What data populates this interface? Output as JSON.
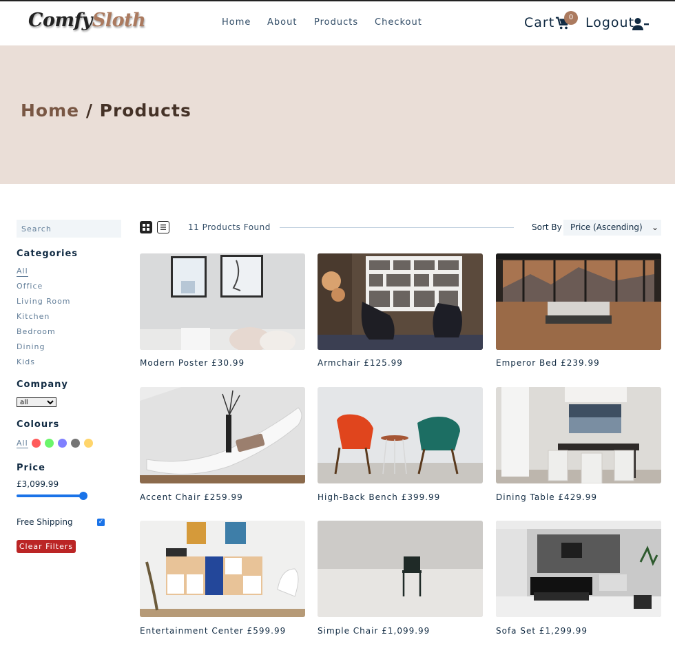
{
  "nav": {
    "logo_part1": "Comfy",
    "logo_part2": "Sloth",
    "links": [
      {
        "label": "Home"
      },
      {
        "label": "About"
      },
      {
        "label": "Products"
      },
      {
        "label": "Checkout"
      }
    ],
    "cart_label": "Cart",
    "cart_count": "0",
    "logout_label": "Logout"
  },
  "hero": {
    "home_crumb": "Home",
    "separator": " / ",
    "current": "Products"
  },
  "filters": {
    "search_placeholder": "Search",
    "categories_title": "Categories",
    "categories": [
      "All",
      "Office",
      "Living Room",
      "Kitchen",
      "Bedroom",
      "Dining",
      "Kids"
    ],
    "company_title": "Company",
    "company_selected": "all",
    "colours_title": "Colours",
    "colours_all": "All",
    "colours": [
      "#ff5a5a",
      "#6bf56b",
      "#8080ff",
      "#757575",
      "#ffd56b"
    ],
    "price_title": "Price",
    "price_value": "£3,099.99",
    "price_fraction": 1.0,
    "shipping_label": "Free Shipping",
    "shipping_checked": true,
    "clear_label": "Clear Filters"
  },
  "sortbar": {
    "found_text": "11 Products Found",
    "sort_label": "Sort By",
    "sort_selected": "Price (Ascending)"
  },
  "products": [
    {
      "name": "Modern Poster",
      "price": "£30.99"
    },
    {
      "name": "Armchair",
      "price": "£125.99"
    },
    {
      "name": "Emperor Bed",
      "price": "£239.99"
    },
    {
      "name": "Accent Chair",
      "price": "£259.99"
    },
    {
      "name": "High-Back Bench",
      "price": "£399.99"
    },
    {
      "name": "Dining Table",
      "price": "£429.99"
    },
    {
      "name": "Entertainment Center",
      "price": "£599.99"
    },
    {
      "name": "Simple Chair",
      "price": "£1,099.99"
    },
    {
      "name": "Sofa Set",
      "price": "£1,299.99"
    }
  ],
  "colors": {
    "accent": "#ab7a5f",
    "hero_bg": "#eaded7",
    "danger": "#bb2525"
  }
}
